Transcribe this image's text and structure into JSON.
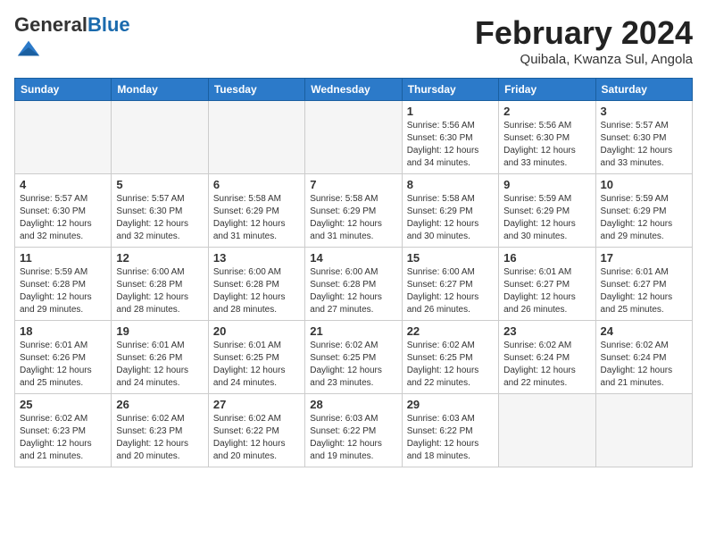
{
  "logo": {
    "general": "General",
    "blue": "Blue"
  },
  "header": {
    "month": "February 2024",
    "location": "Quibala, Kwanza Sul, Angola"
  },
  "weekdays": [
    "Sunday",
    "Monday",
    "Tuesday",
    "Wednesday",
    "Thursday",
    "Friday",
    "Saturday"
  ],
  "weeks": [
    [
      {
        "day": "",
        "info": ""
      },
      {
        "day": "",
        "info": ""
      },
      {
        "day": "",
        "info": ""
      },
      {
        "day": "",
        "info": ""
      },
      {
        "day": "1",
        "info": "Sunrise: 5:56 AM\nSunset: 6:30 PM\nDaylight: 12 hours\nand 34 minutes."
      },
      {
        "day": "2",
        "info": "Sunrise: 5:56 AM\nSunset: 6:30 PM\nDaylight: 12 hours\nand 33 minutes."
      },
      {
        "day": "3",
        "info": "Sunrise: 5:57 AM\nSunset: 6:30 PM\nDaylight: 12 hours\nand 33 minutes."
      }
    ],
    [
      {
        "day": "4",
        "info": "Sunrise: 5:57 AM\nSunset: 6:30 PM\nDaylight: 12 hours\nand 32 minutes."
      },
      {
        "day": "5",
        "info": "Sunrise: 5:57 AM\nSunset: 6:30 PM\nDaylight: 12 hours\nand 32 minutes."
      },
      {
        "day": "6",
        "info": "Sunrise: 5:58 AM\nSunset: 6:29 PM\nDaylight: 12 hours\nand 31 minutes."
      },
      {
        "day": "7",
        "info": "Sunrise: 5:58 AM\nSunset: 6:29 PM\nDaylight: 12 hours\nand 31 minutes."
      },
      {
        "day": "8",
        "info": "Sunrise: 5:58 AM\nSunset: 6:29 PM\nDaylight: 12 hours\nand 30 minutes."
      },
      {
        "day": "9",
        "info": "Sunrise: 5:59 AM\nSunset: 6:29 PM\nDaylight: 12 hours\nand 30 minutes."
      },
      {
        "day": "10",
        "info": "Sunrise: 5:59 AM\nSunset: 6:29 PM\nDaylight: 12 hours\nand 29 minutes."
      }
    ],
    [
      {
        "day": "11",
        "info": "Sunrise: 5:59 AM\nSunset: 6:28 PM\nDaylight: 12 hours\nand 29 minutes."
      },
      {
        "day": "12",
        "info": "Sunrise: 6:00 AM\nSunset: 6:28 PM\nDaylight: 12 hours\nand 28 minutes."
      },
      {
        "day": "13",
        "info": "Sunrise: 6:00 AM\nSunset: 6:28 PM\nDaylight: 12 hours\nand 28 minutes."
      },
      {
        "day": "14",
        "info": "Sunrise: 6:00 AM\nSunset: 6:28 PM\nDaylight: 12 hours\nand 27 minutes."
      },
      {
        "day": "15",
        "info": "Sunrise: 6:00 AM\nSunset: 6:27 PM\nDaylight: 12 hours\nand 26 minutes."
      },
      {
        "day": "16",
        "info": "Sunrise: 6:01 AM\nSunset: 6:27 PM\nDaylight: 12 hours\nand 26 minutes."
      },
      {
        "day": "17",
        "info": "Sunrise: 6:01 AM\nSunset: 6:27 PM\nDaylight: 12 hours\nand 25 minutes."
      }
    ],
    [
      {
        "day": "18",
        "info": "Sunrise: 6:01 AM\nSunset: 6:26 PM\nDaylight: 12 hours\nand 25 minutes."
      },
      {
        "day": "19",
        "info": "Sunrise: 6:01 AM\nSunset: 6:26 PM\nDaylight: 12 hours\nand 24 minutes."
      },
      {
        "day": "20",
        "info": "Sunrise: 6:01 AM\nSunset: 6:25 PM\nDaylight: 12 hours\nand 24 minutes."
      },
      {
        "day": "21",
        "info": "Sunrise: 6:02 AM\nSunset: 6:25 PM\nDaylight: 12 hours\nand 23 minutes."
      },
      {
        "day": "22",
        "info": "Sunrise: 6:02 AM\nSunset: 6:25 PM\nDaylight: 12 hours\nand 22 minutes."
      },
      {
        "day": "23",
        "info": "Sunrise: 6:02 AM\nSunset: 6:24 PM\nDaylight: 12 hours\nand 22 minutes."
      },
      {
        "day": "24",
        "info": "Sunrise: 6:02 AM\nSunset: 6:24 PM\nDaylight: 12 hours\nand 21 minutes."
      }
    ],
    [
      {
        "day": "25",
        "info": "Sunrise: 6:02 AM\nSunset: 6:23 PM\nDaylight: 12 hours\nand 21 minutes."
      },
      {
        "day": "26",
        "info": "Sunrise: 6:02 AM\nSunset: 6:23 PM\nDaylight: 12 hours\nand 20 minutes."
      },
      {
        "day": "27",
        "info": "Sunrise: 6:02 AM\nSunset: 6:22 PM\nDaylight: 12 hours\nand 20 minutes."
      },
      {
        "day": "28",
        "info": "Sunrise: 6:03 AM\nSunset: 6:22 PM\nDaylight: 12 hours\nand 19 minutes."
      },
      {
        "day": "29",
        "info": "Sunrise: 6:03 AM\nSunset: 6:22 PM\nDaylight: 12 hours\nand 18 minutes."
      },
      {
        "day": "",
        "info": ""
      },
      {
        "day": "",
        "info": ""
      }
    ]
  ]
}
